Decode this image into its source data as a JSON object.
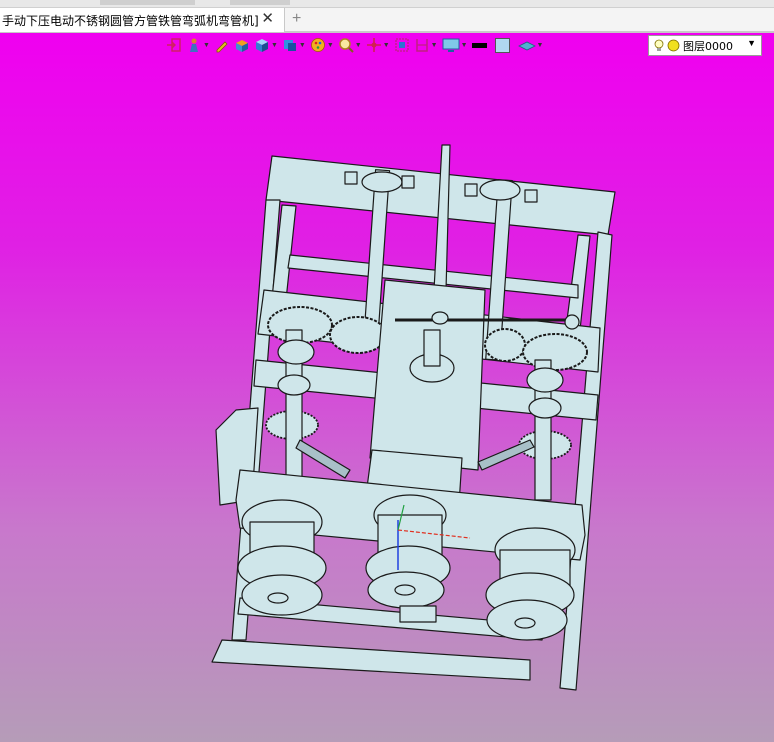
{
  "window": {
    "tab_title": "手动下压电动不锈钢圆管方管铁管弯弧机弯管机]",
    "close_glyph": "✕",
    "add_glyph": "+"
  },
  "toolbar": {
    "layer_label": "图层0000",
    "line_color": "#000000",
    "fill_color": "#b0d8f0",
    "buttons": [
      "exit-icon",
      "person-icon",
      "pen-icon",
      "box-icon",
      "cube-icon",
      "view-cube-icon",
      "palette-icon",
      "zoom-icon",
      "pan-icon",
      "fit-icon",
      "section-icon",
      "display-icon"
    ]
  },
  "scene": {
    "background_top": "#f000f0",
    "background_bottom": "#b59cb8",
    "model_color": "#cfe6ea",
    "model_edge": "#1a1a1a"
  }
}
